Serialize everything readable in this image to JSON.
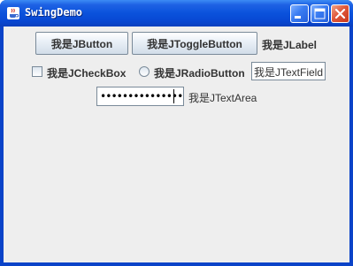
{
  "window": {
    "title": "SwingDemo",
    "app_icon": "java-cup-icon",
    "controls": [
      "minimize-icon",
      "maximize-icon",
      "close-icon"
    ]
  },
  "row1": {
    "button_label": "我是JButton",
    "toggle_label": "我是JToggleButton",
    "label_text": "我是JLabel"
  },
  "row2": {
    "checkbox_label": "我是JCheckBox",
    "checkbox_checked": false,
    "radio_label": "我是JRadioButton",
    "radio_selected": false,
    "textfield_value": "我是JTextField"
  },
  "row3": {
    "password_mask": "••••••••••••••••",
    "textarea_text": "我是JTextArea"
  },
  "colors": {
    "titlebar": "#0a52dc",
    "close_button": "#e0583a",
    "client_bg": "#eeeeee"
  }
}
